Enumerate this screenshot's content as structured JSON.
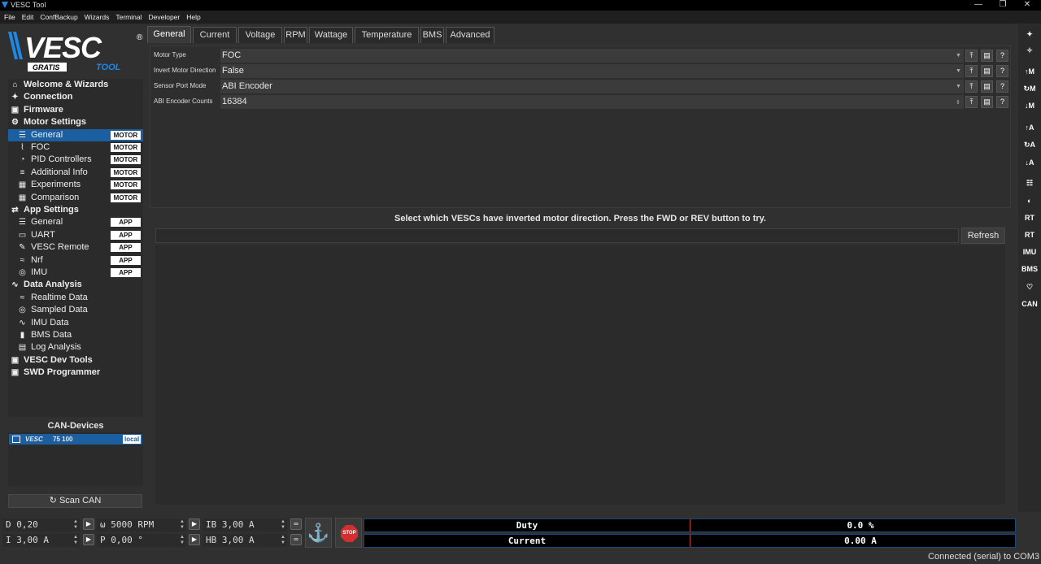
{
  "window": {
    "title": "VESC Tool",
    "controls": [
      "—",
      "❐",
      "✕"
    ]
  },
  "menu": [
    "File",
    "Edit",
    "ConfBackup",
    "Wizards",
    "Terminal",
    "Developer",
    "Help"
  ],
  "logo": {
    "main": "VESC",
    "sub1": "GRATIS",
    "sub2": "TOOL",
    "reg": "®"
  },
  "tree": [
    {
      "label": "Welcome & Wizards",
      "icon": "home-icon",
      "glyph": "⌂",
      "top": true
    },
    {
      "label": "Connection",
      "icon": "plug-icon",
      "glyph": "✦",
      "top": true
    },
    {
      "label": "Firmware",
      "icon": "chip-icon",
      "glyph": "▣",
      "top": true
    },
    {
      "label": "Motor Settings",
      "icon": "motor-icon",
      "glyph": "⚙",
      "top": true
    },
    {
      "label": "General",
      "icon": "sliders-icon",
      "glyph": "☰",
      "tag": "MOTOR",
      "selected": true
    },
    {
      "label": "FOC",
      "icon": "foc-icon",
      "glyph": "⌇",
      "tag": "MOTOR"
    },
    {
      "label": "PID Controllers",
      "icon": "gauge-icon",
      "glyph": "◔",
      "tag": "MOTOR"
    },
    {
      "label": "Additional Info",
      "icon": "info-list-icon",
      "glyph": "≡",
      "tag": "MOTOR"
    },
    {
      "label": "Experiments",
      "icon": "calculator-icon",
      "glyph": "▦",
      "tag": "MOTOR"
    },
    {
      "label": "Comparison",
      "icon": "compare-icon",
      "glyph": "▦",
      "tag": "MOTOR"
    },
    {
      "label": "App Settings",
      "icon": "app-settings-icon",
      "glyph": "⇄",
      "top": true
    },
    {
      "label": "General",
      "icon": "sliders-icon",
      "glyph": "☰",
      "tag": "APP"
    },
    {
      "label": "UART",
      "icon": "uart-icon",
      "glyph": "▭",
      "tag": "APP"
    },
    {
      "label": "VESC Remote",
      "icon": "remote-icon",
      "glyph": "✎",
      "tag": "APP"
    },
    {
      "label": "Nrf",
      "icon": "wireless-icon",
      "glyph": "≈",
      "tag": "APP"
    },
    {
      "label": "IMU",
      "icon": "imu-icon",
      "glyph": "◎",
      "tag": "APP"
    },
    {
      "label": "Data Analysis",
      "icon": "analysis-icon",
      "glyph": "∿",
      "top": true
    },
    {
      "label": "Realtime Data",
      "icon": "realtime-icon",
      "glyph": "≈"
    },
    {
      "label": "Sampled Data",
      "icon": "sampled-icon",
      "glyph": "◎"
    },
    {
      "label": "IMU Data",
      "icon": "imu-data-icon",
      "glyph": "∿"
    },
    {
      "label": "BMS Data",
      "icon": "battery-icon",
      "glyph": "▮"
    },
    {
      "label": "Log Analysis",
      "icon": "log-icon",
      "glyph": "▤"
    },
    {
      "label": "VESC Dev Tools",
      "icon": "devtools-icon",
      "glyph": "▣",
      "top": true
    },
    {
      "label": "SWD Programmer",
      "icon": "programmer-icon",
      "glyph": "▣",
      "top": true
    }
  ],
  "can": {
    "title": "CAN-Devices",
    "device": "75 100",
    "device_logo": "VESC",
    "device_tag": "local",
    "scan_label": "Scan CAN",
    "scan_glyph": "↻"
  },
  "tabs": [
    "General",
    "Current",
    "Voltage",
    "RPM",
    "Wattage",
    "Temperature",
    "BMS",
    "Advanced"
  ],
  "settings": [
    {
      "label": "Motor Type",
      "value": "FOC",
      "kind": "combo"
    },
    {
      "label": "Invert Motor Direction",
      "value": "False",
      "kind": "combo"
    },
    {
      "label": "Sensor Port Mode",
      "value": "ABI Encoder",
      "kind": "combo"
    },
    {
      "label": "ABI Encoder Counts",
      "value": "16384",
      "kind": "spin"
    }
  ],
  "message": "Select which VESCs have inverted motor direction. Press the FWD or REV button to try.",
  "refresh_label": "Refresh",
  "right_tools": [
    {
      "icon": "plug-connect-icon",
      "glyph": "✦"
    },
    {
      "icon": "plug-disconnect-icon",
      "glyph": "✧"
    },
    {
      "icon": "read-motor-config-icon",
      "glyph": "↑M"
    },
    {
      "icon": "reload-motor-config-icon",
      "glyph": "↻M"
    },
    {
      "icon": "write-motor-config-icon",
      "glyph": "↓M"
    },
    {
      "icon": "read-app-config-icon",
      "glyph": "↑A"
    },
    {
      "icon": "reload-app-config-icon",
      "glyph": "↻A"
    },
    {
      "icon": "write-app-config-icon",
      "glyph": "↓A"
    },
    {
      "icon": "can-network-icon",
      "glyph": "☷"
    },
    {
      "icon": "gamepad-icon",
      "glyph": "◐"
    },
    {
      "icon": "rt-data-icon",
      "glyph": "RT"
    },
    {
      "icon": "rt-app-icon",
      "glyph": "RT"
    },
    {
      "icon": "imu-stream-icon",
      "glyph": "IMU"
    },
    {
      "icon": "bms-stream-icon",
      "glyph": "BMS"
    },
    {
      "icon": "heart-icon",
      "glyph": "♡"
    },
    {
      "icon": "can-forward-icon",
      "glyph": "CAN"
    }
  ],
  "controls": {
    "duty": "D 0,20",
    "rpm": "ω 5000 RPM",
    "ib": "IB 3,00 A",
    "current": "I 3,00 A",
    "pos": "P 0,00 °",
    "hb": "HB 3,00 A"
  },
  "meters": [
    {
      "name": "Duty",
      "value": "0.0 %"
    },
    {
      "name": "Current",
      "value": "0.00 A"
    }
  ],
  "status": "Connected (serial) to COM3"
}
